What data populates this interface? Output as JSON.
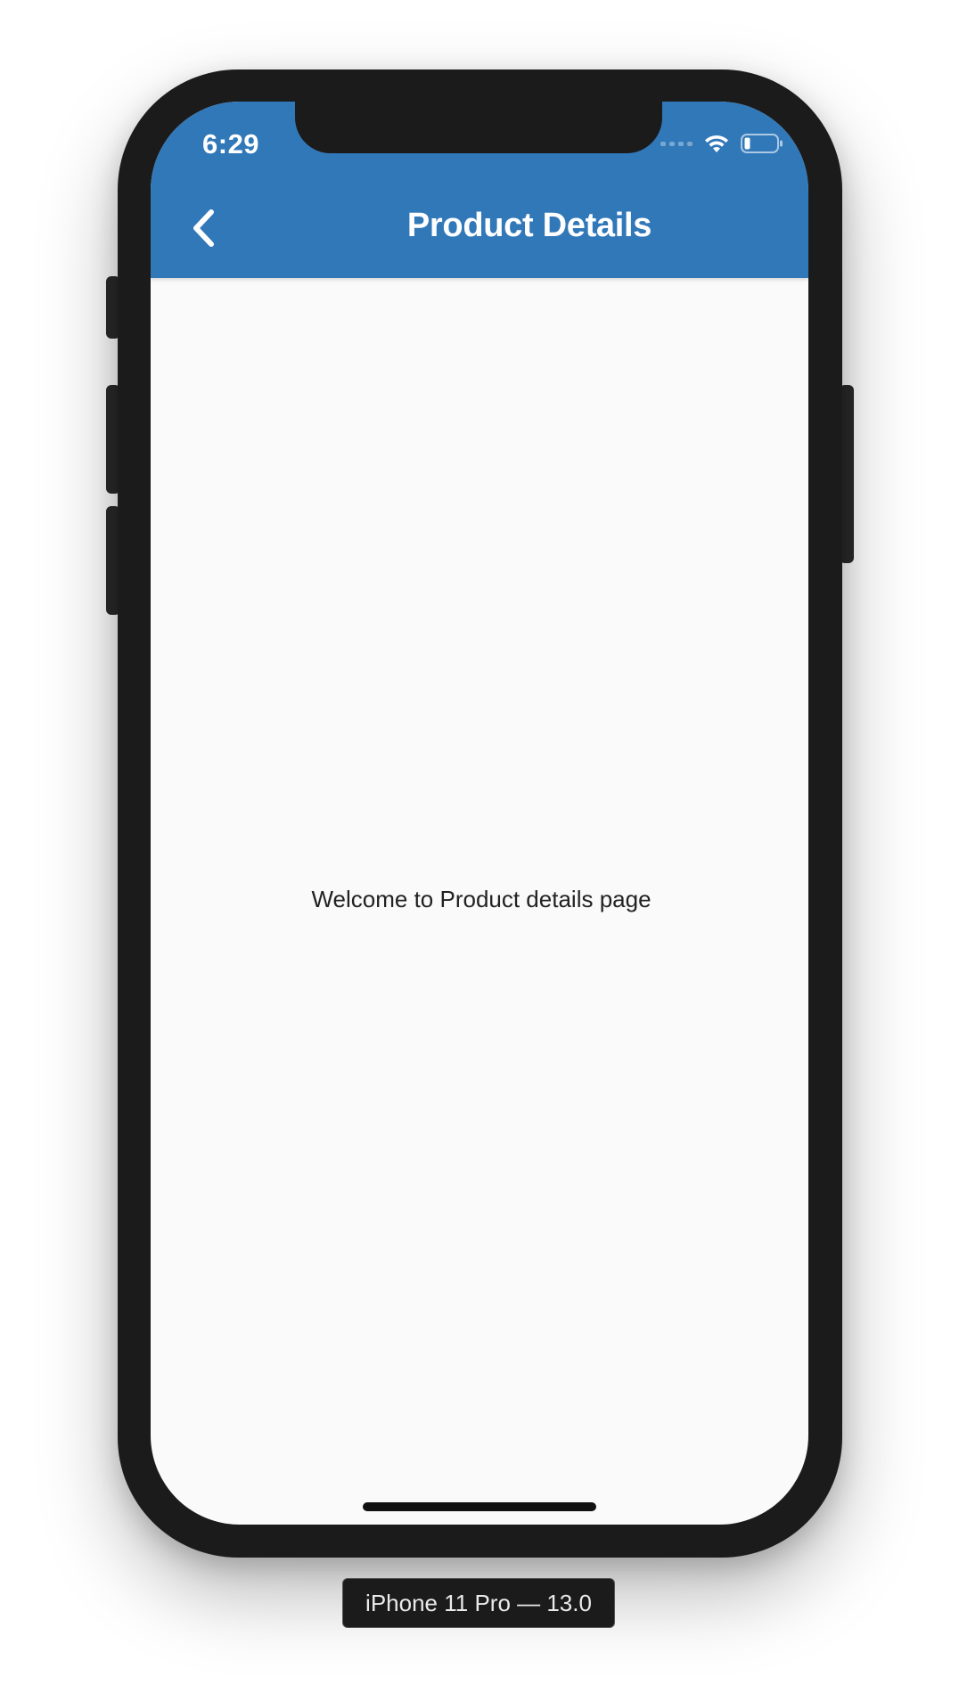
{
  "status_bar": {
    "time": "6:29",
    "icons": [
      "signal-icon",
      "wifi-icon",
      "battery-icon"
    ]
  },
  "app_bar": {
    "title": "Product Details",
    "back_icon": "chevron-left-icon",
    "background_color": "#3178b9"
  },
  "content": {
    "message": "Welcome to Product details page"
  },
  "device": {
    "label": "iPhone 11 Pro — 13.0"
  }
}
